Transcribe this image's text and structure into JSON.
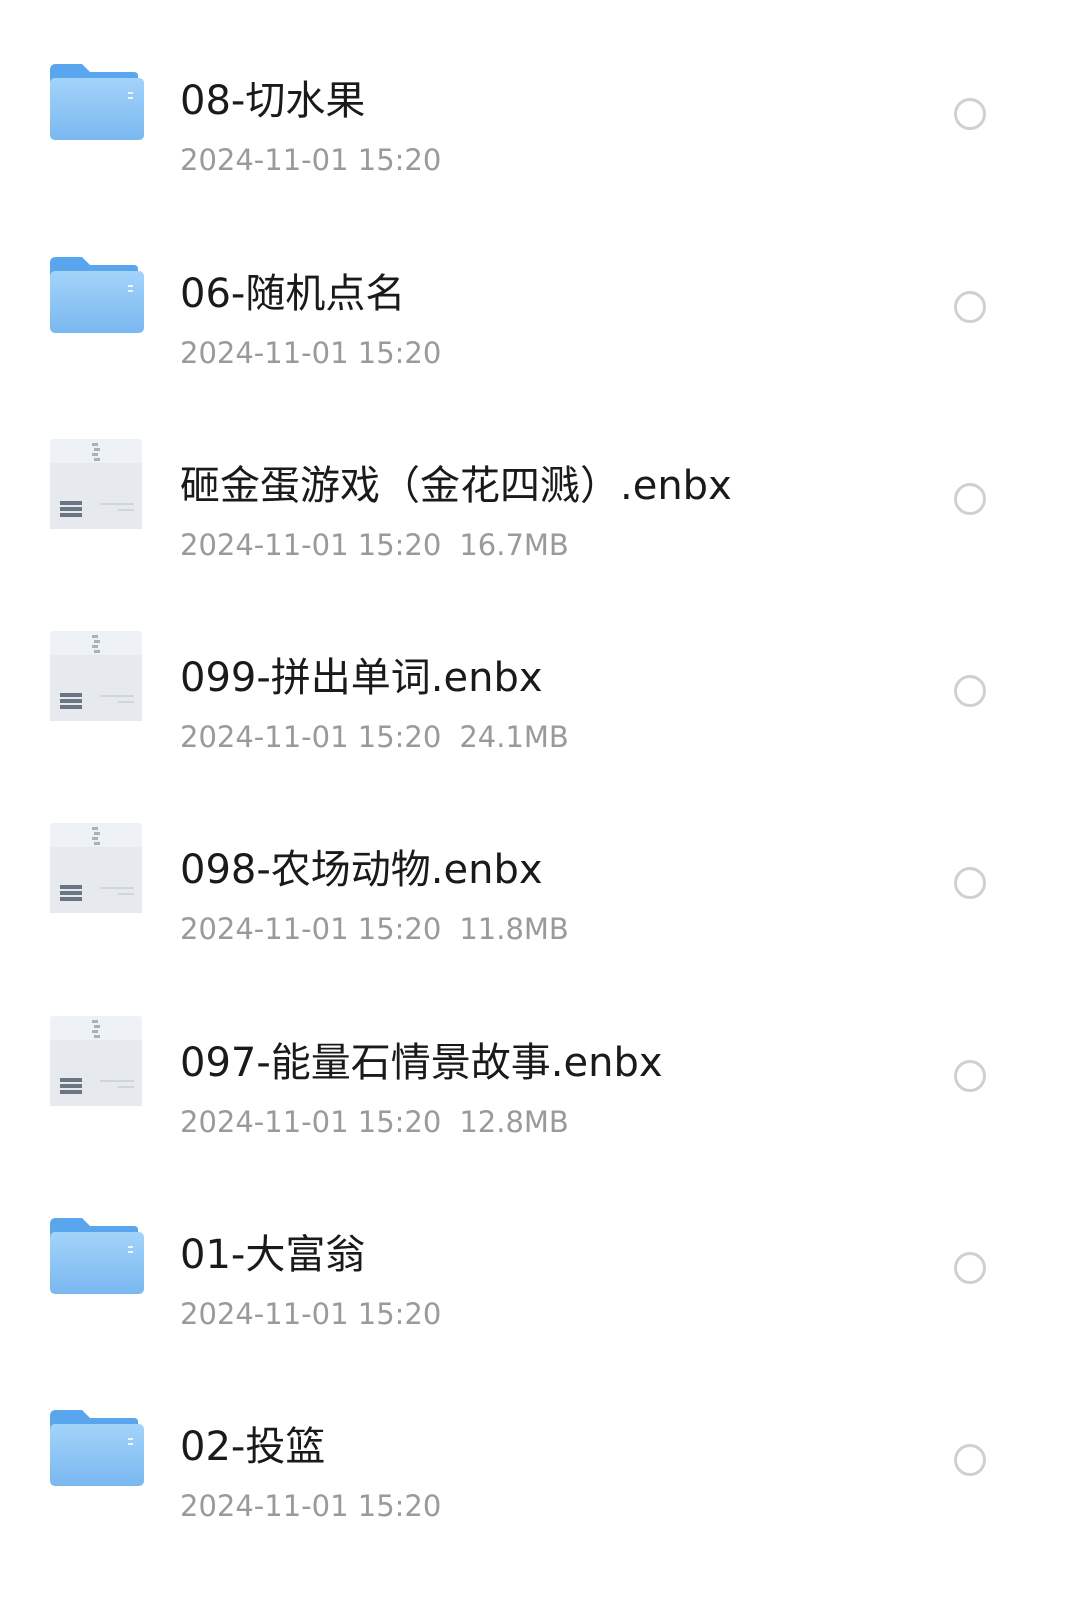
{
  "files": [
    {
      "name": "08-切水果",
      "date": "2024-11-01 15:20",
      "size": "",
      "kind": "folder",
      "icon": "folder-icon"
    },
    {
      "name": "06-随机点名",
      "date": "2024-11-01 15:20",
      "size": "",
      "kind": "folder",
      "icon": "folder-icon"
    },
    {
      "name": "砸金蛋游戏（金花四溅）.enbx",
      "date": "2024-11-01 15:20",
      "size": "16.7MB",
      "kind": "archive",
      "icon": "archive-file-icon"
    },
    {
      "name": "099-拼出单词.enbx",
      "date": "2024-11-01 15:20",
      "size": "24.1MB",
      "kind": "archive",
      "icon": "archive-file-icon"
    },
    {
      "name": "098-农场动物.enbx",
      "date": "2024-11-01 15:20",
      "size": "11.8MB",
      "kind": "archive",
      "icon": "archive-file-icon"
    },
    {
      "name": "097-能量石情景故事.enbx",
      "date": "2024-11-01 15:20",
      "size": "12.8MB",
      "kind": "archive",
      "icon": "archive-file-icon"
    },
    {
      "name": "01-大富翁",
      "date": "2024-11-01 15:20",
      "size": "",
      "kind": "folder",
      "icon": "folder-icon"
    },
    {
      "name": "02-投篮",
      "date": "2024-11-01 15:20",
      "size": "",
      "kind": "folder",
      "icon": "folder-icon"
    }
  ],
  "colors": {
    "folder_back": "#5aa6ee",
    "folder_front": "#8cc6f6",
    "text_primary": "#1a1a1a",
    "text_secondary": "#9a9a9a",
    "radio_border": "#d0d0d0"
  }
}
